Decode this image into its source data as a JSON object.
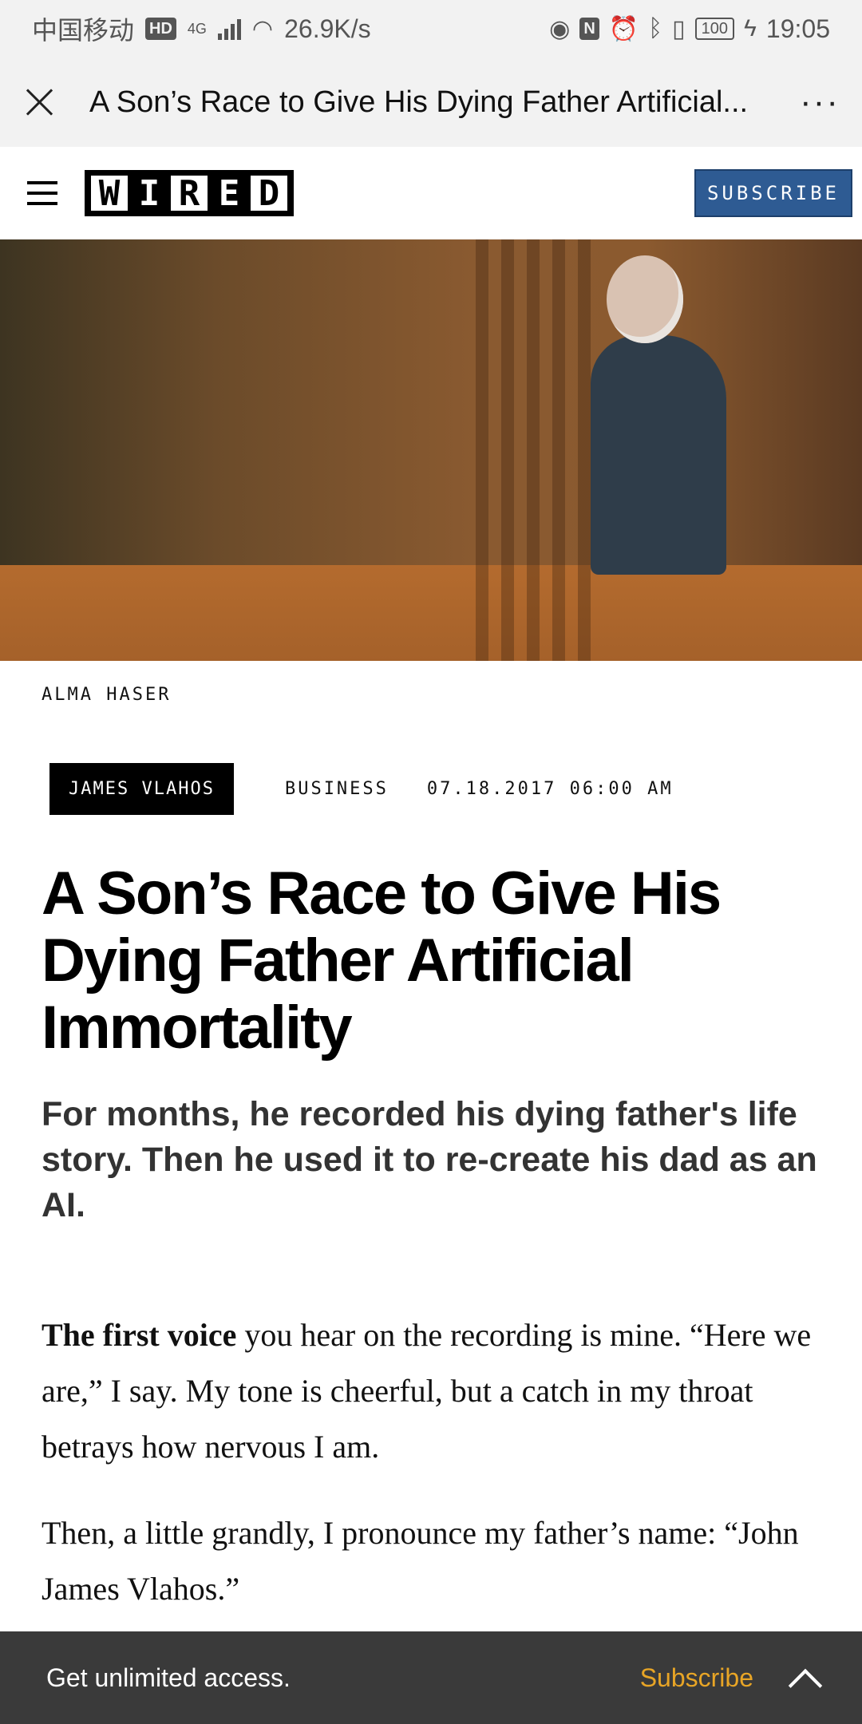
{
  "status_bar": {
    "carrier": "中国移动",
    "hd_badge": "HD",
    "network": "4G",
    "speed": "26.9K/s",
    "nfc_label": "N",
    "battery": "100",
    "time": "19:05"
  },
  "browser": {
    "title": "A Son’s Race to Give His Dying Father Artificial..."
  },
  "site_header": {
    "logo_letters": [
      "W",
      "I",
      "R",
      "E",
      "D"
    ],
    "subscribe_label": "SUBSCRIBE"
  },
  "article": {
    "photo_credit": "ALMA HASER",
    "author": "JAMES VLAHOS",
    "category": "BUSINESS",
    "date": "07.18.2017 06:00 AM",
    "headline": "A Son’s Race to Give His Dying Father Artificial Immortality",
    "dek": "For months, he recorded his dying father's life story. Then he used it to re-create his dad as an AI.",
    "p1_lead": "The first voice",
    "p1_rest": " you hear on the recording is mine. “Here we are,” I say. My tone is cheerful, but a catch in my throat betrays how nervous I am.",
    "p2": "Then, a little grandly, I pronounce my father’s name: “John James Vlahos.”"
  },
  "bottom_bar": {
    "message": "Get unlimited access.",
    "subscribe_label": "Subscribe"
  }
}
